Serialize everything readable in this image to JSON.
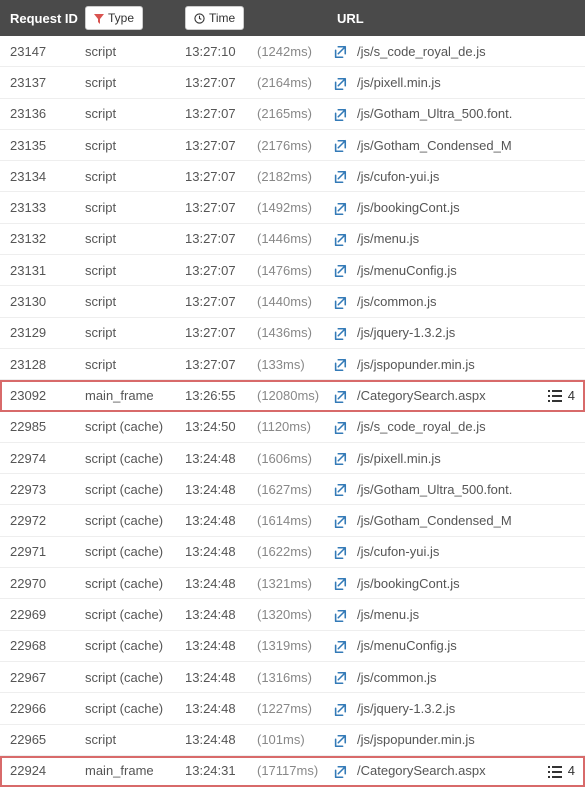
{
  "header": {
    "col_id": "Request ID",
    "type_btn": "Type",
    "time_btn": "Time",
    "col_url": "URL"
  },
  "icons": {
    "filter": "filter-icon",
    "clock": "clock-icon",
    "external": "external-link-icon",
    "list": "list-icon"
  },
  "rows": [
    {
      "id": "23147",
      "type": "script",
      "time": "13:27:10",
      "dur": "(1242ms)",
      "url": "/js/s_code_royal_de.js",
      "hl": false,
      "badge": null
    },
    {
      "id": "23137",
      "type": "script",
      "time": "13:27:07",
      "dur": "(2164ms)",
      "url": "/js/pixell.min.js",
      "hl": false,
      "badge": null
    },
    {
      "id": "23136",
      "type": "script",
      "time": "13:27:07",
      "dur": "(2165ms)",
      "url": "/js/Gotham_Ultra_500.font.",
      "hl": false,
      "badge": null
    },
    {
      "id": "23135",
      "type": "script",
      "time": "13:27:07",
      "dur": "(2176ms)",
      "url": "/js/Gotham_Condensed_M",
      "hl": false,
      "badge": null
    },
    {
      "id": "23134",
      "type": "script",
      "time": "13:27:07",
      "dur": "(2182ms)",
      "url": "/js/cufon-yui.js",
      "hl": false,
      "badge": null
    },
    {
      "id": "23133",
      "type": "script",
      "time": "13:27:07",
      "dur": "(1492ms)",
      "url": "/js/bookingCont.js",
      "hl": false,
      "badge": null
    },
    {
      "id": "23132",
      "type": "script",
      "time": "13:27:07",
      "dur": "(1446ms)",
      "url": "/js/menu.js",
      "hl": false,
      "badge": null
    },
    {
      "id": "23131",
      "type": "script",
      "time": "13:27:07",
      "dur": "(1476ms)",
      "url": "/js/menuConfig.js",
      "hl": false,
      "badge": null
    },
    {
      "id": "23130",
      "type": "script",
      "time": "13:27:07",
      "dur": "(1440ms)",
      "url": "/js/common.js",
      "hl": false,
      "badge": null
    },
    {
      "id": "23129",
      "type": "script",
      "time": "13:27:07",
      "dur": "(1436ms)",
      "url": "/js/jquery-1.3.2.js",
      "hl": false,
      "badge": null
    },
    {
      "id": "23128",
      "type": "script",
      "time": "13:27:07",
      "dur": "(133ms)",
      "url": "/js/jspopunder.min.js",
      "hl": false,
      "badge": null
    },
    {
      "id": "23092",
      "type": "main_frame",
      "time": "13:26:55",
      "dur": "(12080ms)",
      "url": "/CategorySearch.aspx",
      "hl": true,
      "badge": "4"
    },
    {
      "id": "22985",
      "type": "script (cache)",
      "time": "13:24:50",
      "dur": "(1120ms)",
      "url": "/js/s_code_royal_de.js",
      "hl": false,
      "badge": null
    },
    {
      "id": "22974",
      "type": "script (cache)",
      "time": "13:24:48",
      "dur": "(1606ms)",
      "url": "/js/pixell.min.js",
      "hl": false,
      "badge": null
    },
    {
      "id": "22973",
      "type": "script (cache)",
      "time": "13:24:48",
      "dur": "(1627ms)",
      "url": "/js/Gotham_Ultra_500.font.",
      "hl": false,
      "badge": null
    },
    {
      "id": "22972",
      "type": "script (cache)",
      "time": "13:24:48",
      "dur": "(1614ms)",
      "url": "/js/Gotham_Condensed_M",
      "hl": false,
      "badge": null
    },
    {
      "id": "22971",
      "type": "script (cache)",
      "time": "13:24:48",
      "dur": "(1622ms)",
      "url": "/js/cufon-yui.js",
      "hl": false,
      "badge": null
    },
    {
      "id": "22970",
      "type": "script (cache)",
      "time": "13:24:48",
      "dur": "(1321ms)",
      "url": "/js/bookingCont.js",
      "hl": false,
      "badge": null
    },
    {
      "id": "22969",
      "type": "script (cache)",
      "time": "13:24:48",
      "dur": "(1320ms)",
      "url": "/js/menu.js",
      "hl": false,
      "badge": null
    },
    {
      "id": "22968",
      "type": "script (cache)",
      "time": "13:24:48",
      "dur": "(1319ms)",
      "url": "/js/menuConfig.js",
      "hl": false,
      "badge": null
    },
    {
      "id": "22967",
      "type": "script (cache)",
      "time": "13:24:48",
      "dur": "(1316ms)",
      "url": "/js/common.js",
      "hl": false,
      "badge": null
    },
    {
      "id": "22966",
      "type": "script (cache)",
      "time": "13:24:48",
      "dur": "(1227ms)",
      "url": "/js/jquery-1.3.2.js",
      "hl": false,
      "badge": null
    },
    {
      "id": "22965",
      "type": "script",
      "time": "13:24:48",
      "dur": "(101ms)",
      "url": "/js/jspopunder.min.js",
      "hl": false,
      "badge": null
    },
    {
      "id": "22924",
      "type": "main_frame",
      "time": "13:24:31",
      "dur": "(17117ms)",
      "url": "/CategorySearch.aspx",
      "hl": true,
      "badge": "4"
    }
  ]
}
